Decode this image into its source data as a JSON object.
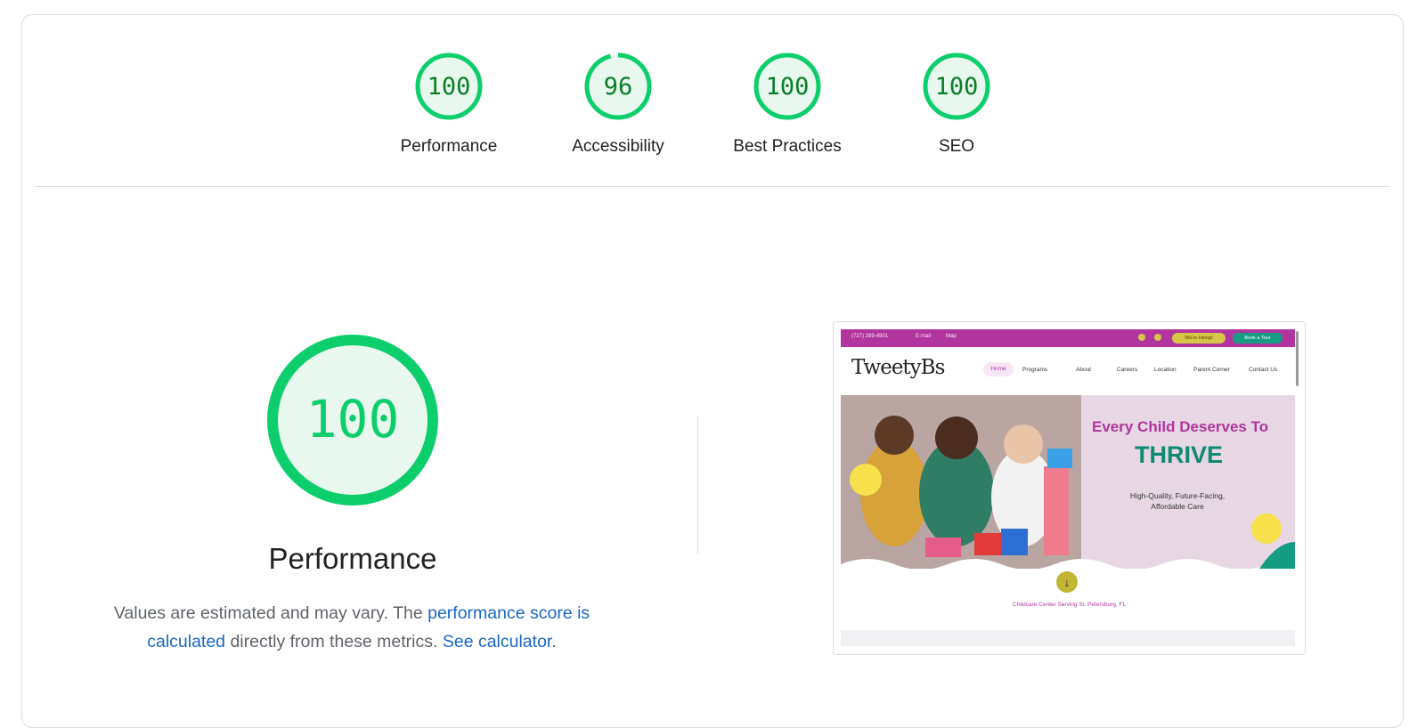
{
  "gauges": [
    {
      "score": "100",
      "label": "Performance"
    },
    {
      "score": "96",
      "label": "Accessibility"
    },
    {
      "score": "100",
      "label": "Best Practices"
    },
    {
      "score": "100",
      "label": "SEO"
    }
  ],
  "main": {
    "score": "100",
    "title": "Performance",
    "desc_prefix": "Values are estimated and may vary. The ",
    "desc_link1": "performance score is calculated",
    "desc_middle": " directly from these metrics. ",
    "desc_link2": "See calculator",
    "desc_suffix": "."
  },
  "screenshot": {
    "topbar": {
      "phone": "(727) 289-4501",
      "email": "E-mail",
      "map": "Map",
      "hiring": "We're Hiring!",
      "tour": "Book a Tour"
    },
    "logo": "TweetyBs",
    "nav": [
      "Home",
      "Programs",
      "About",
      "Careers",
      "Location",
      "Parent Corner",
      "Contact Us"
    ],
    "hero_heading": "Every Child Deserves To",
    "hero_emphasis": "THRIVE",
    "hero_sub": "High-Quality, Future-Facing, Affordable Care",
    "caption": "Childcare Center Serving St. Petersburg, FL"
  },
  "colors": {
    "pass_green": "#0cce6b",
    "pass_text": "#0a7d27",
    "pass_fill": "#e8f8ee",
    "link_blue": "#1a66c9",
    "brand_magenta": "#b2359f",
    "brand_teal": "#0f8a72"
  }
}
